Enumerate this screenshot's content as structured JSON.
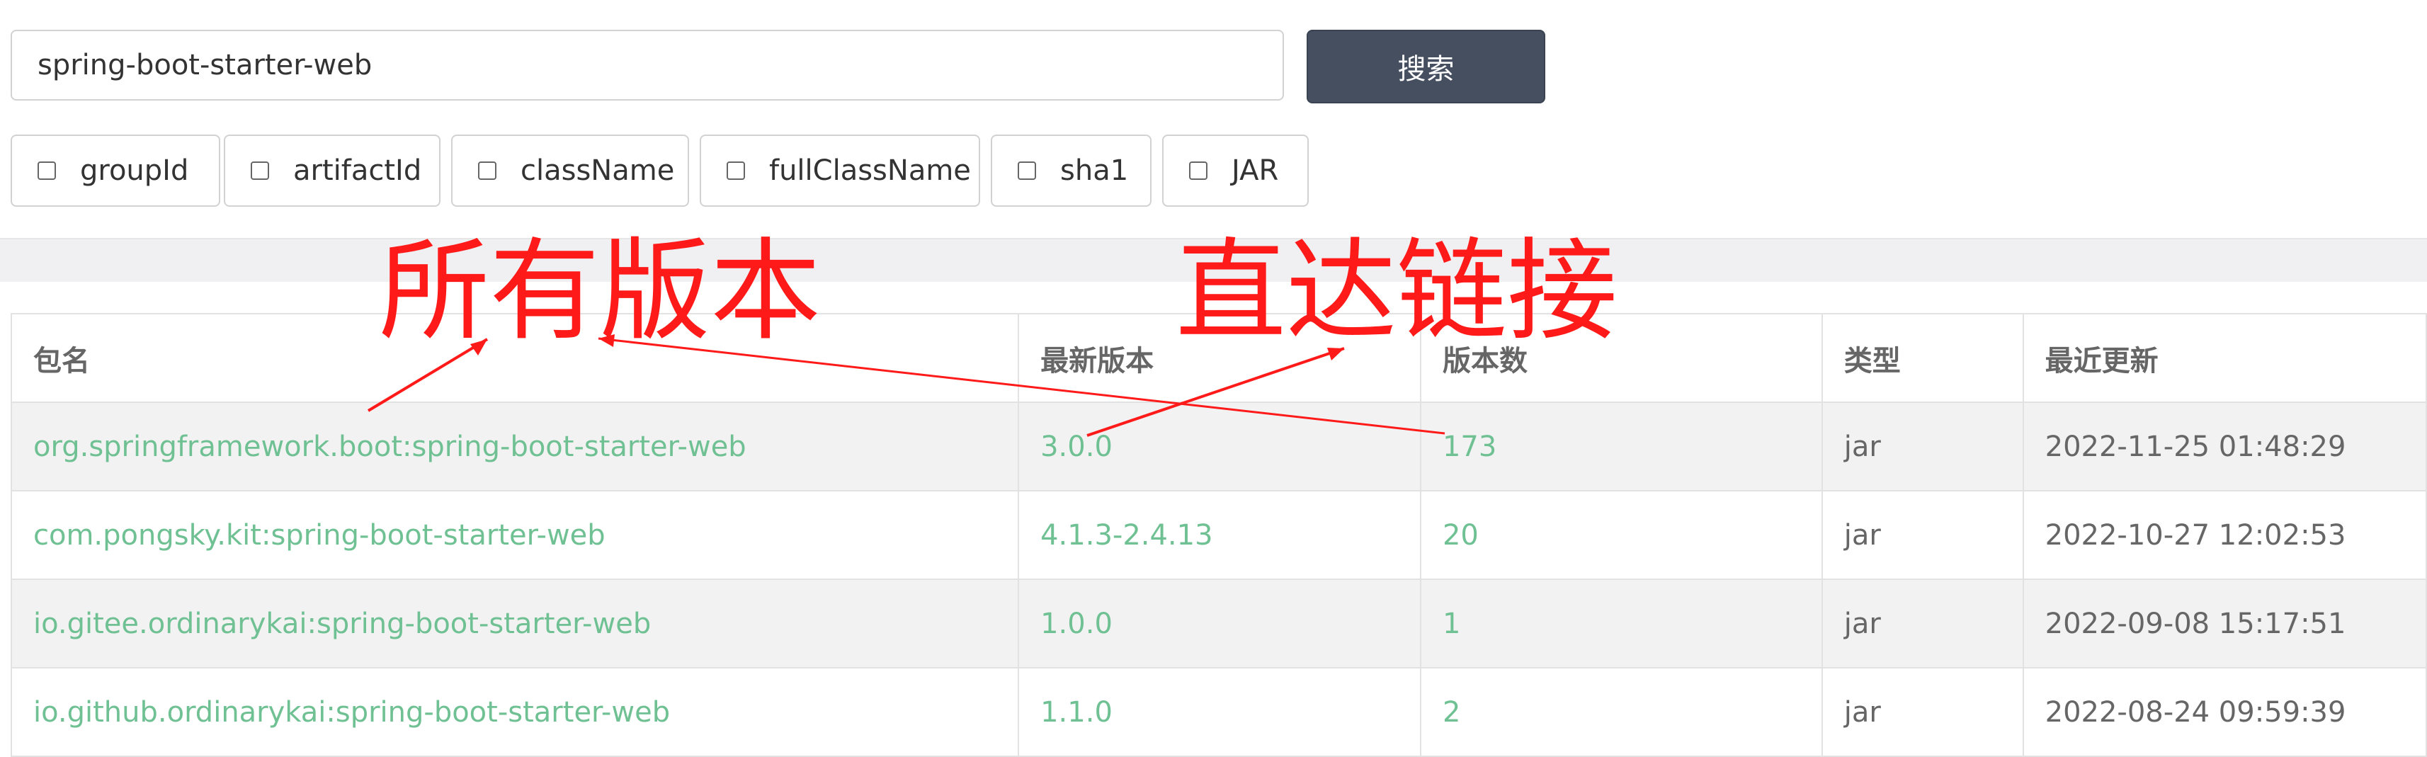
{
  "search": {
    "value": "spring-boot-starter-web",
    "button_label": "搜索"
  },
  "filters": [
    {
      "label": "groupId",
      "checked": false
    },
    {
      "label": "artifactId",
      "checked": false
    },
    {
      "label": "className",
      "checked": false
    },
    {
      "label": "fullClassName",
      "checked": false
    },
    {
      "label": "sha1",
      "checked": false
    },
    {
      "label": "JAR",
      "checked": false
    }
  ],
  "table": {
    "headers": [
      "包名",
      "最新版本",
      "版本数",
      "类型",
      "最近更新"
    ],
    "rows": [
      {
        "package": "org.springframework.boot:spring-boot-starter-web",
        "latest_version": "3.0.0",
        "version_count": "173",
        "type": "jar",
        "updated": "2022-11-25 01:48:29"
      },
      {
        "package": "com.pongsky.kit:spring-boot-starter-web",
        "latest_version": "4.1.3-2.4.13",
        "version_count": "20",
        "type": "jar",
        "updated": "2022-10-27 12:02:53"
      },
      {
        "package": "io.gitee.ordinarykai:spring-boot-starter-web",
        "latest_version": "1.0.0",
        "version_count": "1",
        "type": "jar",
        "updated": "2022-09-08 15:17:51"
      },
      {
        "package": "io.github.ordinarykai:spring-boot-starter-web",
        "latest_version": "1.1.0",
        "version_count": "2",
        "type": "jar",
        "updated": "2022-08-24 09:59:39"
      }
    ]
  },
  "annotations": {
    "all_versions": "所有版本",
    "direct_link": "直达链接",
    "color": "#ff1a1a"
  },
  "colors": {
    "button_bg": "#454f60",
    "link": "#6fc193",
    "stripe": "#f2f2f2"
  }
}
